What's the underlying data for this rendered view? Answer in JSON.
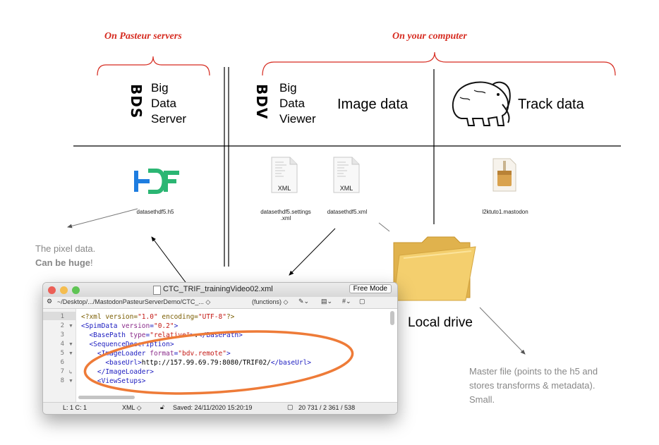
{
  "headers": {
    "pasteur": "On Pasteur servers",
    "computer": "On your computer"
  },
  "bds": {
    "logo": "BDS",
    "line1": "Big",
    "line2": "Data",
    "line3": "Server"
  },
  "bdv": {
    "logo": "BDV",
    "line1": "Big",
    "line2": "Data",
    "line3": "Viewer",
    "image_data": "Image data"
  },
  "track": {
    "label": "Track data"
  },
  "files": {
    "hdf_logo": "HDF",
    "h5": "datasethdf5.h5",
    "settings_line1": "datasethdf5.settings",
    "settings_line2": ".xml",
    "xml": "datasethdf5.xml",
    "xml_badge": "XML",
    "mastodon": "l2ktuto1.mastodon"
  },
  "notes": {
    "pixel_line1": "The pixel data.",
    "pixel_bold": "Can be huge",
    "pixel_excl": "!",
    "master": [
      "Master file (points to the h5 and",
      "stores transforms & metadata).",
      "Small."
    ],
    "local_drive": "Local drive"
  },
  "editor": {
    "title": "CTC_TRIF_trainingVideo02.xml",
    "free_mode": "Free Mode",
    "path": "~/Desktop/.../MastodonPasteurServerDemo/CTC_... ◇",
    "functions": "(functions) ◇",
    "lines": [
      "1",
      "2",
      "3",
      "4",
      "5",
      "6",
      "7",
      "8"
    ],
    "status_pos": "L: 1 C: 1",
    "status_lang": "XML ◇",
    "status_saved": "Saved: 24/11/2020 15:20:19",
    "status_counts": "20 731 / 2 361 / 538"
  }
}
